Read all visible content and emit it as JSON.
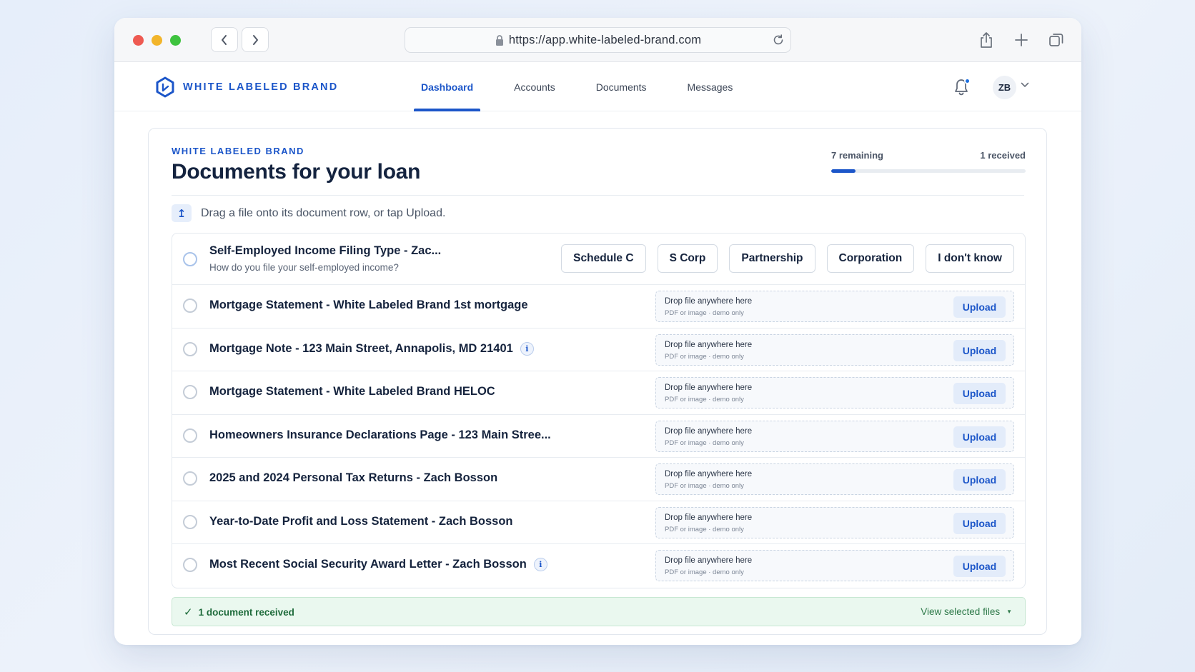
{
  "browser": {
    "url": "https://app.white-labeled-brand.com"
  },
  "nav": {
    "brand": "WHITE LABELED BRAND",
    "tabs": [
      {
        "label": "Dashboard",
        "active": true
      },
      {
        "label": "Accounts",
        "active": false
      },
      {
        "label": "Documents",
        "active": false
      },
      {
        "label": "Messages",
        "active": false
      }
    ],
    "avatar_initials": "ZB",
    "accent_color": "#1c56c9"
  },
  "page": {
    "eyebrow": "WHITE LABELED BRAND",
    "title": "Documents for your loan",
    "progress": {
      "remaining_label": "7 remaining",
      "received_label": "1 received",
      "fraction_complete": 0.125
    },
    "hint": "Drag a file onto its document row, or tap Upload."
  },
  "question_row": {
    "title": "Self-Employed Income Filing Type - Zac...",
    "subtitle": "How do you file your self-employed income?",
    "options": [
      "Schedule C",
      "S Corp",
      "Partnership",
      "Corporation",
      "I don't know"
    ]
  },
  "dropzone": {
    "primary": "Drop file anywhere here",
    "secondary": "PDF or image · demo only",
    "button": "Upload"
  },
  "documents": [
    {
      "title": "Mortgage Statement - White Labeled Brand 1st mortgage",
      "info": false
    },
    {
      "title": "Mortgage Note - 123 Main Street, Annapolis, MD 21401",
      "info": true
    },
    {
      "title": "Mortgage Statement - White Labeled Brand HELOC",
      "info": false
    },
    {
      "title": "Homeowners Insurance Declarations Page - 123 Main Stree...",
      "info": false
    },
    {
      "title": "2025 and 2024 Personal Tax Returns - Zach Bosson",
      "info": false
    },
    {
      "title": "Year-to-Date Profit and Loss Statement - Zach Bosson",
      "info": false
    },
    {
      "title": "Most Recent Social Security Award Letter - Zach Bosson",
      "info": true
    }
  ],
  "footer": {
    "received_text": "1 document received",
    "view_link": "View selected files"
  }
}
